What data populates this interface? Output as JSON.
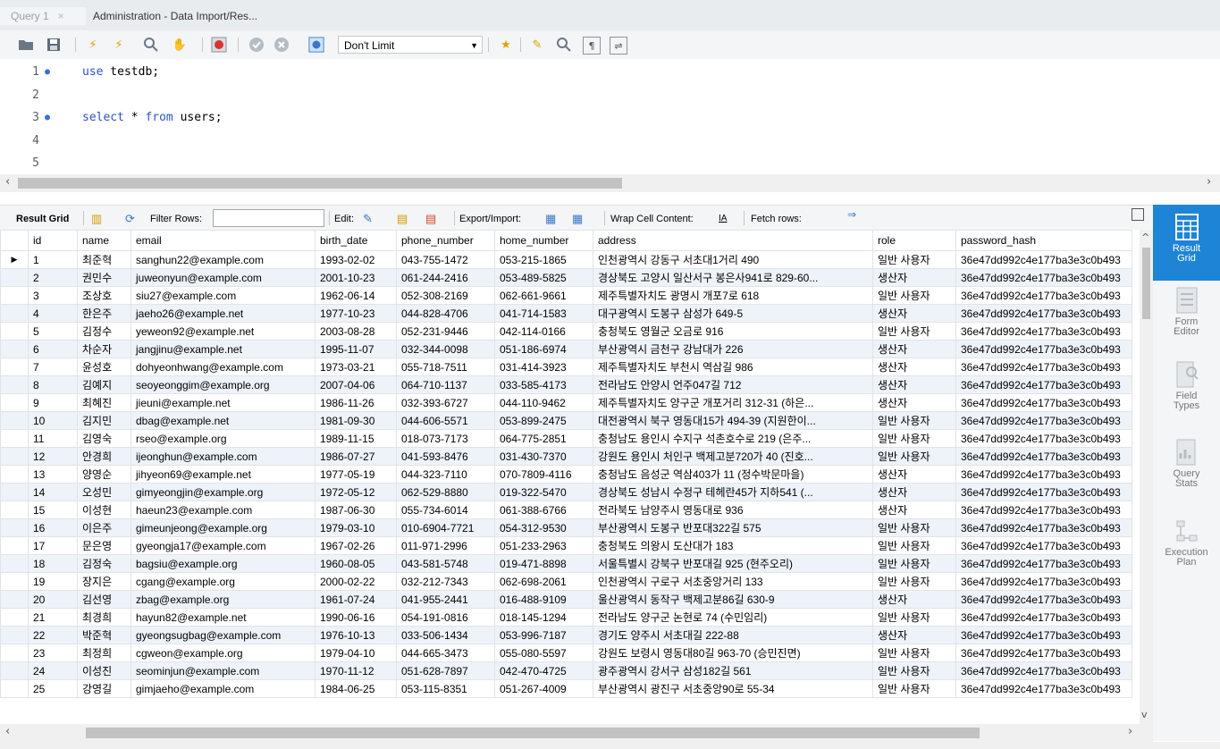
{
  "tabs": [
    {
      "label": "Query 1"
    },
    {
      "label": "Administration - Data Import/Res..."
    }
  ],
  "toolbar": {
    "limit_value": "Don't Limit"
  },
  "editor": {
    "lines": [
      {
        "no": "1",
        "code": "use testdb;"
      },
      {
        "no": "2",
        "code": ""
      },
      {
        "no": "3",
        "code": "select * from users;"
      },
      {
        "no": "4",
        "code": ""
      },
      {
        "no": "5",
        "code": ""
      }
    ]
  },
  "result_toolbar": {
    "result_grid": "Result Grid",
    "filter_rows": "Filter Rows:",
    "edit": "Edit:",
    "export_import": "Export/Import:",
    "wrap": "Wrap Cell Content:",
    "fetch": "Fetch rows:"
  },
  "grid": {
    "columns": [
      "id",
      "name",
      "email",
      "birth_date",
      "phone_number",
      "home_number",
      "address",
      "role",
      "password_hash"
    ],
    "rows": [
      [
        "1",
        "최준혁",
        "sanghun22@example.com",
        "1993-02-02",
        "043-755-1472",
        "053-215-1865",
        "인천광역시 강동구 서초대1거리 490",
        "일반 사용자",
        "36e47dd992c4e177ba3e3c0b493"
      ],
      [
        "2",
        "권민수",
        "juweonyun@example.com",
        "2001-10-23",
        "061-244-2416",
        "053-489-5825",
        "경상북도 고양시 일산서구 봉은사941로 829-60...",
        "생산자",
        "36e47dd992c4e177ba3e3c0b493"
      ],
      [
        "3",
        "조상호",
        "siu27@example.com",
        "1962-06-14",
        "052-308-2169",
        "062-661-9661",
        "제주특별자치도 광명시 개포7로 618",
        "일반 사용자",
        "36e47dd992c4e177ba3e3c0b493"
      ],
      [
        "4",
        "한은주",
        "jaeho26@example.net",
        "1977-10-23",
        "044-828-4706",
        "041-714-1583",
        "대구광역시 도봉구 삼성가 649-5",
        "생산자",
        "36e47dd992c4e177ba3e3c0b493"
      ],
      [
        "5",
        "김정수",
        "yeweon92@example.net",
        "2003-08-28",
        "052-231-9446",
        "042-114-0166",
        "충청북도 영월군 오금로 916",
        "일반 사용자",
        "36e47dd992c4e177ba3e3c0b493"
      ],
      [
        "6",
        "차순자",
        "jangjinu@example.net",
        "1995-11-07",
        "032-344-0098",
        "051-186-6974",
        "부산광역시 금천구 강남대가 226",
        "생산자",
        "36e47dd992c4e177ba3e3c0b493"
      ],
      [
        "7",
        "윤성호",
        "dohyeonhwang@example.com",
        "1973-03-21",
        "055-718-7511",
        "031-414-3923",
        "제주특별자치도 부천시 역삼길 986",
        "생산자",
        "36e47dd992c4e177ba3e3c0b493"
      ],
      [
        "8",
        "김예지",
        "seoyeonggim@example.org",
        "2007-04-06",
        "064-710-1137",
        "033-585-4173",
        "전라남도 안양시 언주047길 712",
        "생산자",
        "36e47dd992c4e177ba3e3c0b493"
      ],
      [
        "9",
        "최혜진",
        "jieuni@example.net",
        "1986-11-26",
        "032-393-6727",
        "044-110-9462",
        "제주특별자치도 양구군 개포거리 312-31 (하은...",
        "생산자",
        "36e47dd992c4e177ba3e3c0b493"
      ],
      [
        "10",
        "김지민",
        "dbag@example.net",
        "1981-09-30",
        "044-606-5571",
        "053-899-2475",
        "대전광역시 북구 영동대15가 494-39 (지원한이...",
        "일반 사용자",
        "36e47dd992c4e177ba3e3c0b493"
      ],
      [
        "11",
        "김영숙",
        "rseo@example.org",
        "1989-11-15",
        "018-073-7173",
        "064-775-2851",
        "충청남도 용인시 수지구 석촌호수로 219 (은주...",
        "일반 사용자",
        "36e47dd992c4e177ba3e3c0b493"
      ],
      [
        "12",
        "안경희",
        "ijeonghun@example.com",
        "1986-07-27",
        "041-593-8476",
        "031-430-7370",
        "강원도 용인시 처인구 백제고분720가 40 (진호...",
        "일반 사용자",
        "36e47dd992c4e177ba3e3c0b493"
      ],
      [
        "13",
        "양영순",
        "jihyeon69@example.net",
        "1977-05-19",
        "044-323-7110",
        "070-7809-4116",
        "충청남도 음성군 역삼403가 11 (정수박문마을)",
        "생산자",
        "36e47dd992c4e177ba3e3c0b493"
      ],
      [
        "14",
        "오성민",
        "gimyeongjin@example.org",
        "1972-05-12",
        "062-529-8880",
        "019-322-5470",
        "경상북도 성남시 수정구 테헤란45가 지하541 (...",
        "생산자",
        "36e47dd992c4e177ba3e3c0b493"
      ],
      [
        "15",
        "이성현",
        "haeun23@example.com",
        "1987-06-30",
        "055-734-6014",
        "061-388-6766",
        "전라북도 남양주시 영동대로 936",
        "생산자",
        "36e47dd992c4e177ba3e3c0b493"
      ],
      [
        "16",
        "이은주",
        "gimeunjeong@example.org",
        "1979-03-10",
        "010-6904-7721",
        "054-312-9530",
        "부산광역시 도봉구 반포대322길 575",
        "일반 사용자",
        "36e47dd992c4e177ba3e3c0b493"
      ],
      [
        "17",
        "문은영",
        "gyeongja17@example.com",
        "1967-02-26",
        "011-971-2996",
        "051-233-2963",
        "충청북도 의왕시 도산대가 183",
        "일반 사용자",
        "36e47dd992c4e177ba3e3c0b493"
      ],
      [
        "18",
        "김정숙",
        "bagsiu@example.org",
        "1960-08-05",
        "043-581-5748",
        "019-471-8898",
        "서울특별시 강북구 반포대길 925 (현주오리)",
        "일반 사용자",
        "36e47dd992c4e177ba3e3c0b493"
      ],
      [
        "19",
        "장지은",
        "cgang@example.org",
        "2000-02-22",
        "032-212-7343",
        "062-698-2061",
        "인천광역시 구로구 서초중앙거리 133",
        "일반 사용자",
        "36e47dd992c4e177ba3e3c0b493"
      ],
      [
        "20",
        "김선영",
        "zbag@example.org",
        "1961-07-24",
        "041-955-2441",
        "016-488-9109",
        "울산광역시 동작구 백제고분86길 630-9",
        "생산자",
        "36e47dd992c4e177ba3e3c0b493"
      ],
      [
        "21",
        "최경희",
        "hayun82@example.net",
        "1990-06-16",
        "054-191-0816",
        "018-145-1294",
        "전라남도 양구군 논현로 74 (수민임리)",
        "일반 사용자",
        "36e47dd992c4e177ba3e3c0b493"
      ],
      [
        "22",
        "박준혁",
        "gyeongsugbag@example.com",
        "1976-10-13",
        "033-506-1434",
        "053-996-7187",
        "경기도 양주시 서초대길 222-88",
        "생산자",
        "36e47dd992c4e177ba3e3c0b493"
      ],
      [
        "23",
        "최정희",
        "cgweon@example.org",
        "1979-04-10",
        "044-665-3473",
        "055-080-5597",
        "강원도 보령시 영동대80길 963-70 (승민진면)",
        "일반 사용자",
        "36e47dd992c4e177ba3e3c0b493"
      ],
      [
        "24",
        "이성진",
        "seominjun@example.com",
        "1970-11-12",
        "051-628-7897",
        "042-470-4725",
        "광주광역시 강서구 삼성182길 561",
        "일반 사용자",
        "36e47dd992c4e177ba3e3c0b493"
      ],
      [
        "25",
        "강영길",
        "gimjaeho@example.com",
        "1984-06-25",
        "053-115-8351",
        "051-267-4009",
        "부산광역시 광진구 서초중앙90로 55-34",
        "일반 사용자",
        "36e47dd992c4e177ba3e3c0b493"
      ]
    ]
  },
  "side_panel": [
    {
      "label1": "Result",
      "label2": "Grid",
      "icon": "result-grid-icon"
    },
    {
      "label1": "Form",
      "label2": "Editor",
      "icon": "form-editor-icon"
    },
    {
      "label1": "Field",
      "label2": "Types",
      "icon": "field-types-icon"
    },
    {
      "label1": "Query",
      "label2": "Stats",
      "icon": "query-stats-icon"
    },
    {
      "label1": "Execution",
      "label2": "Plan",
      "icon": "execution-plan-icon"
    }
  ],
  "colors": {
    "accent": "#1e84d6",
    "keyword": "#2d52c4",
    "alt_row": "#eef3fa"
  }
}
